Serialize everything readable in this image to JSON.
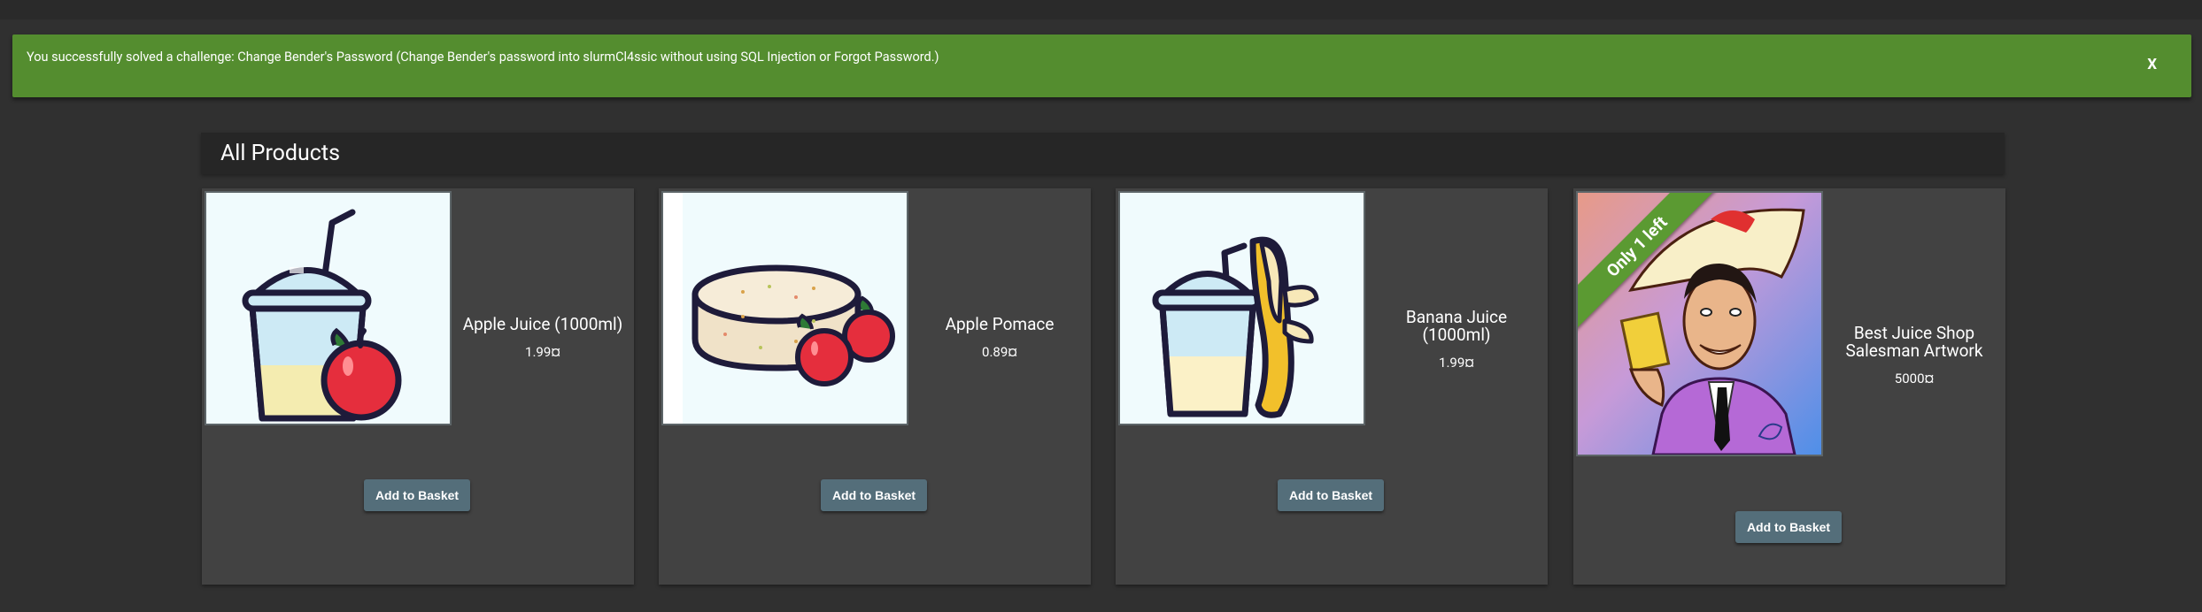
{
  "banner": {
    "message": "You successfully solved a challenge: Change Bender's Password (Change Bender's password into slurmCl4ssic without using SQL Injection or Forgot Password.)",
    "close_label": "X",
    "color": "#548d2f"
  },
  "page": {
    "heading": "All Products"
  },
  "products": [
    {
      "name": "Apple Juice (1000ml)",
      "price": "1.99¤",
      "button": "Add to Basket",
      "icon": "apple-juice-icon"
    },
    {
      "name": "Apple Pomace",
      "price": "0.89¤",
      "button": "Add to Basket",
      "icon": "apple-pomace-icon"
    },
    {
      "name": "Banana Juice (1000ml)",
      "price": "1.99¤",
      "button": "Add to Basket",
      "icon": "banana-juice-icon"
    },
    {
      "name": "Best Juice Shop Salesman Artwork",
      "price": "5000¤",
      "button": "Add to Basket",
      "ribbon": "Only 1 left",
      "icon": "salesman-artwork"
    }
  ],
  "colors": {
    "background": "#303030",
    "card": "#424242",
    "button": "#546e7a",
    "ribbon": "#5b9a32"
  }
}
